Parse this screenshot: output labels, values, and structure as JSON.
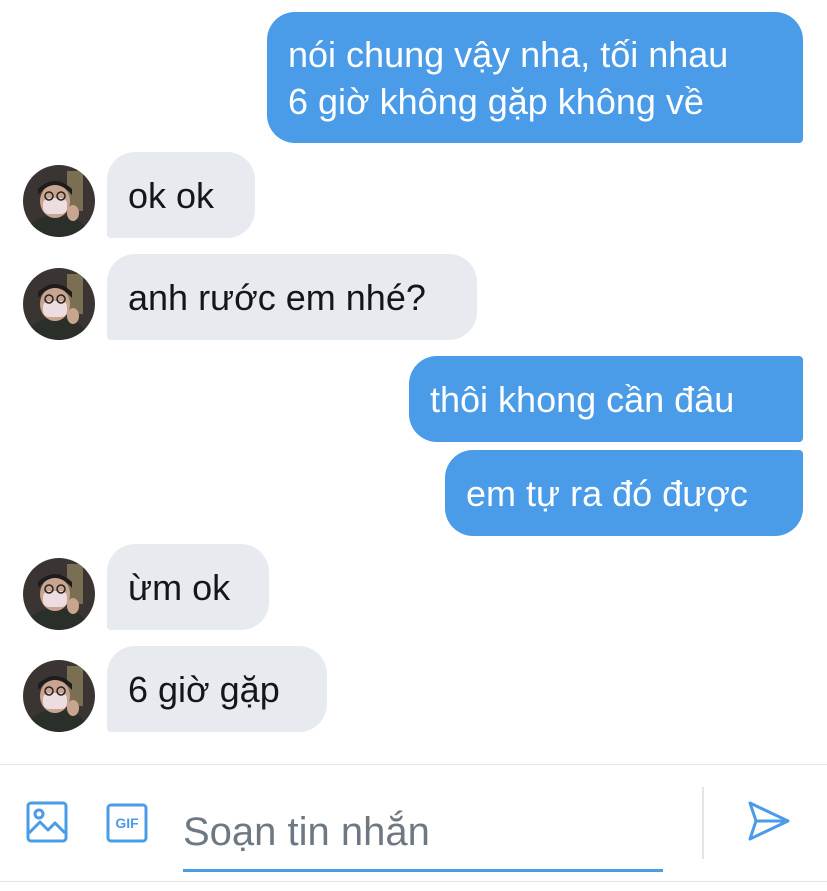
{
  "conversation": {
    "messages": [
      {
        "direction": "outgoing",
        "lines": [
          "nói chung vậy nha, tối nhau",
          "6 giờ không gặp không về"
        ]
      },
      {
        "direction": "incoming",
        "text": "ok ok"
      },
      {
        "direction": "incoming",
        "text": "anh rước em nhé?"
      },
      {
        "direction": "outgoing",
        "text": "thôi khong cần đâu"
      },
      {
        "direction": "outgoing",
        "text": "em tự ra đó được"
      },
      {
        "direction": "incoming",
        "text": "ừm ok"
      },
      {
        "direction": "incoming",
        "text": "6 giờ gặp"
      }
    ]
  },
  "composer": {
    "placeholder": "Soạn tin nhắn",
    "value": "",
    "media_icon": "image-icon",
    "gif_icon": "gif-icon",
    "gif_label": "GIF",
    "send_icon": "send-icon"
  },
  "colors": {
    "accent": "#4a9be8",
    "incoming_bubble": "#e7eaee",
    "outgoing_text": "#ffffff",
    "incoming_text": "#14171a",
    "placeholder": "#6d7883",
    "divider": "#e1e4e8"
  }
}
